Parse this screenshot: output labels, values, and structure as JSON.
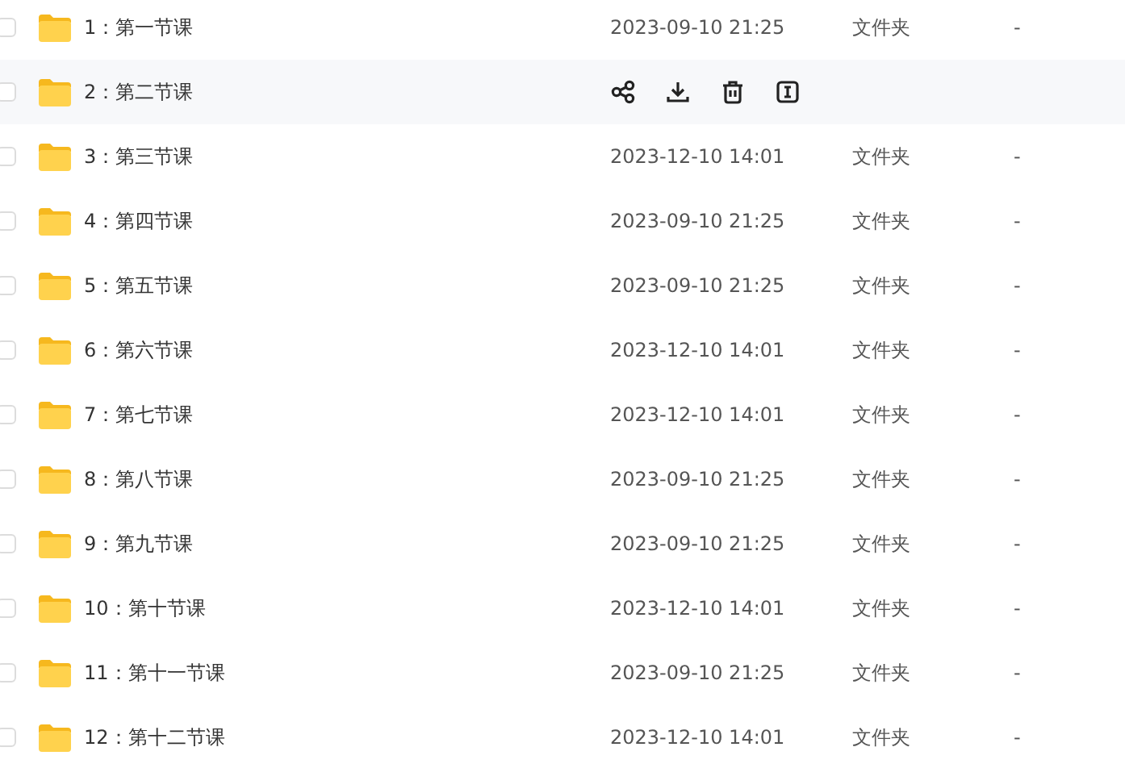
{
  "rows": [
    {
      "name": "1：第一节课",
      "date": "2023-09-10 21:25",
      "category": "文件夹",
      "size": "-",
      "checked": false,
      "hovered": false
    },
    {
      "name": "2：第二节课",
      "checked": false,
      "hovered": true
    },
    {
      "name": "3：第三节课",
      "date": "2023-12-10 14:01",
      "category": "文件夹",
      "size": "-",
      "checked": false,
      "hovered": false
    },
    {
      "name": "4：第四节课",
      "date": "2023-09-10 21:25",
      "category": "文件夹",
      "size": "-",
      "checked": false,
      "hovered": false
    },
    {
      "name": "5：第五节课",
      "date": "2023-09-10 21:25",
      "category": "文件夹",
      "size": "-",
      "checked": false,
      "hovered": false
    },
    {
      "name": "6：第六节课",
      "date": "2023-12-10 14:01",
      "category": "文件夹",
      "size": "-",
      "checked": false,
      "hovered": false
    },
    {
      "name": "7：第七节课",
      "date": "2023-12-10 14:01",
      "category": "文件夹",
      "size": "-",
      "checked": false,
      "hovered": false
    },
    {
      "name": "8：第八节课",
      "date": "2023-09-10 21:25",
      "category": "文件夹",
      "size": "-",
      "checked": false,
      "hovered": false
    },
    {
      "name": "9：第九节课",
      "date": "2023-09-10 21:25",
      "category": "文件夹",
      "size": "-",
      "checked": false,
      "hovered": false
    },
    {
      "name": "10：第十节课",
      "date": "2023-12-10 14:01",
      "category": "文件夹",
      "size": "-",
      "checked": false,
      "hovered": false
    },
    {
      "name": "11：第十一节课",
      "date": "2023-09-10 21:25",
      "category": "文件夹",
      "size": "-",
      "checked": false,
      "hovered": false
    },
    {
      "name": "12：第十二节课",
      "date": "2023-12-10 14:01",
      "category": "文件夹",
      "size": "-",
      "checked": false,
      "hovered": false
    }
  ]
}
